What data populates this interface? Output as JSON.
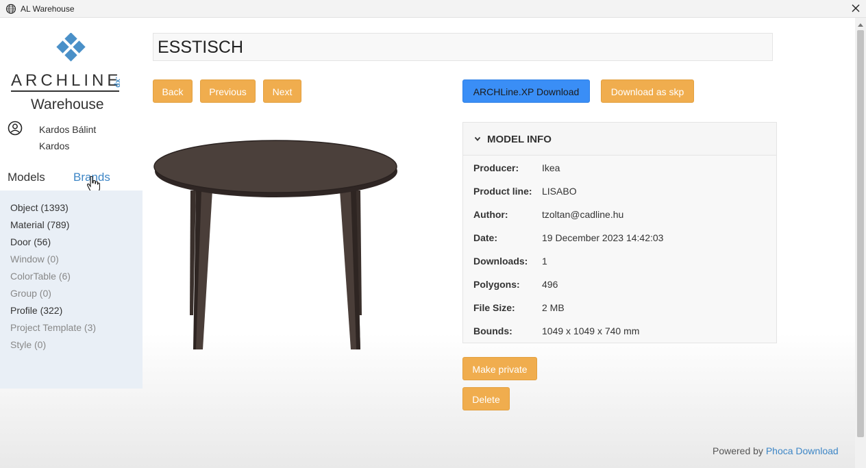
{
  "window": {
    "title": "AL Warehouse",
    "globe_icon": "globe-icon",
    "close_icon": "close-icon"
  },
  "logo": {
    "wordmark": "ARCHLINE",
    "suffix": ".xp",
    "subtitle": "Warehouse",
    "accent_color": "#3d86c6"
  },
  "user": {
    "icon": "user-circle-icon",
    "name": "Kardos Bálint Kardos"
  },
  "tabs": {
    "models": "Models",
    "brands": "Brands"
  },
  "categories": [
    {
      "label": "Object (1393)",
      "state": "active"
    },
    {
      "label": "Material (789)",
      "state": "active"
    },
    {
      "label": "Door (56)",
      "state": "active"
    },
    {
      "label": "Window (0)",
      "state": "muted"
    },
    {
      "label": "ColorTable (6)",
      "state": "muted"
    },
    {
      "label": "Group (0)",
      "state": "muted"
    },
    {
      "label": "Profile (322)",
      "state": "active"
    },
    {
      "label": "Project Template (3)",
      "state": "muted"
    },
    {
      "label": "Style (0)",
      "state": "muted"
    }
  ],
  "model": {
    "title": "ESSTISCH"
  },
  "nav_buttons": {
    "back": "Back",
    "previous": "Previous",
    "next": "Next"
  },
  "download_buttons": {
    "archline": "ARCHLine.XP Download",
    "skp": "Download as skp"
  },
  "model_info": {
    "header": "MODEL INFO",
    "rows": [
      {
        "key": "Producer:",
        "value": "Ikea"
      },
      {
        "key": "Product line:",
        "value": "LISABO"
      },
      {
        "key": "Author:",
        "value": "tzoltan@cadline.hu"
      },
      {
        "key": "Date:",
        "value": "19 December 2023 14:42:03"
      },
      {
        "key": "Downloads:",
        "value": "1"
      },
      {
        "key": "Polygons:",
        "value": "496"
      },
      {
        "key": "File Size:",
        "value": "2 MB"
      },
      {
        "key": "Bounds:",
        "value": "1049 x 1049 x 740 mm"
      }
    ]
  },
  "actions": {
    "make_private": "Make private",
    "delete": "Delete"
  },
  "footer": {
    "prefix": "Powered by ",
    "link": "Phoca Download"
  },
  "colors": {
    "orange_button": "#f0ad4e",
    "blue_button": "#3a8ef6",
    "category_panel": "#e9eff6"
  }
}
